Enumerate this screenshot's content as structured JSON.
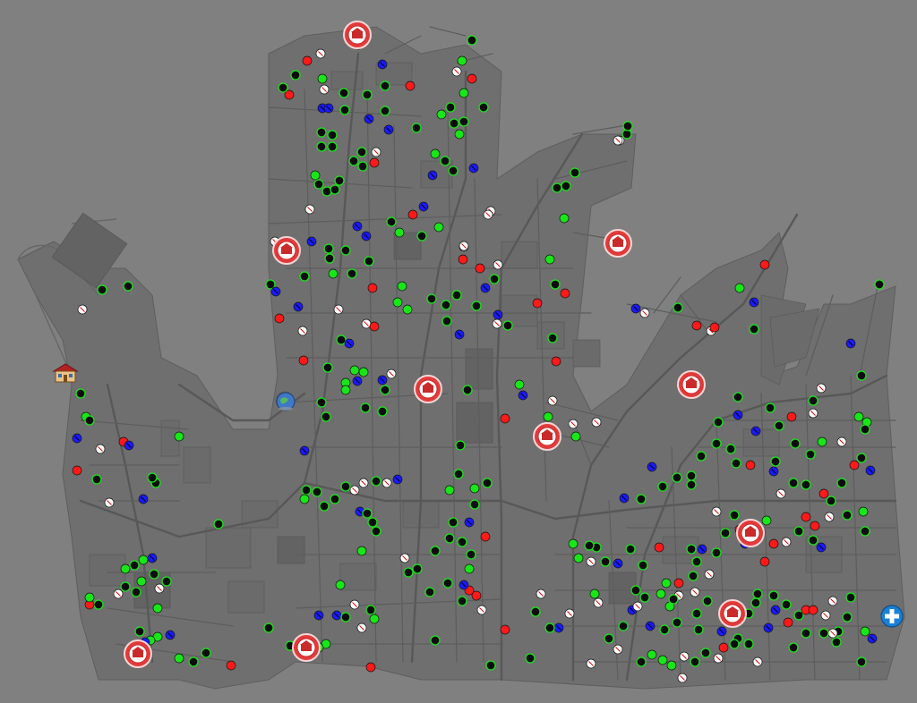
{
  "map": {
    "background": "#808080",
    "road_color": "#5d5d5d",
    "legend_colors": {
      "green": "#19e619",
      "red": "#ff1a1a",
      "blue": "#1a1aff",
      "white": "#ffffff",
      "black": "#000000"
    }
  },
  "markers": {
    "station_icons": [
      {
        "name": "station-marker-north-icon"
      },
      {
        "name": "station-marker-northwest-icon"
      },
      {
        "name": "station-marker-east-icon"
      },
      {
        "name": "station-marker-center-icon"
      },
      {
        "name": "station-marker-east2-icon"
      },
      {
        "name": "station-marker-center2-icon"
      },
      {
        "name": "station-marker-southeast-icon"
      },
      {
        "name": "station-marker-southeast2-icon"
      },
      {
        "name": "station-marker-southwest-icon"
      },
      {
        "name": "station-marker-south-icon"
      }
    ],
    "special_icons": [
      "house-icon",
      "globe-icon",
      "hospital-plus-icon"
    ]
  }
}
